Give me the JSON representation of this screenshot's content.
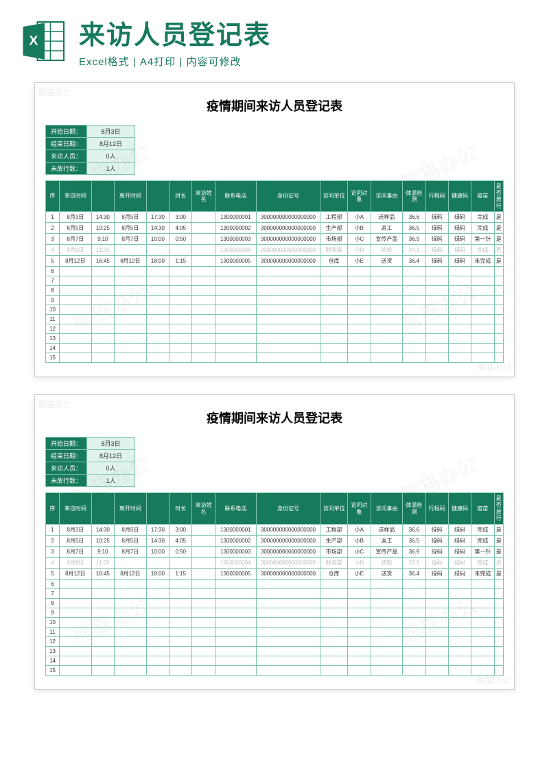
{
  "header": {
    "main_title": "来访人员登记表",
    "sub_title": "Excel格式 | A4打印 | 内容可修改"
  },
  "sheet": {
    "title": "疫情期间来访人员登记表",
    "meta": [
      {
        "label": "开始日期：",
        "value": "8月3日"
      },
      {
        "label": "结束日期：",
        "value": "8月12日"
      },
      {
        "label": "来访人员：",
        "value": "0人"
      },
      {
        "label": "未放行数：",
        "value": "1人"
      }
    ],
    "columns": [
      "序",
      "来访时间",
      "",
      "离开时间",
      "",
      "时长",
      "来访姓名",
      "联系电话",
      "身份证号",
      "访问单位",
      "访问对象",
      "访问事由",
      "体温检测",
      "行程码",
      "健康码",
      "疫苗",
      "是否放行"
    ],
    "rows": [
      {
        "n": "1",
        "d1": "8月3日",
        "t1": "14:30",
        "d2": "8月5日",
        "t2": "17:30",
        "dur": "3:00",
        "name": "",
        "phone": "1300000001",
        "id": "300000000000000000",
        "dept": "工程部",
        "who": "小A",
        "why": "送样品",
        "temp": "36.6",
        "trip": "绿码",
        "health": "绿码",
        "vac": "完成",
        "ok": "是",
        "dim": false
      },
      {
        "n": "2",
        "d1": "8月5日",
        "t1": "10:25",
        "d2": "8月5日",
        "t2": "14:30",
        "dur": "4:05",
        "name": "",
        "phone": "1300000002",
        "id": "300000000000000000",
        "dept": "生产部",
        "who": "小B",
        "why": "返工",
        "temp": "36.5",
        "trip": "绿码",
        "health": "绿码",
        "vac": "完成",
        "ok": "是",
        "dim": false
      },
      {
        "n": "3",
        "d1": "8月7日",
        "t1": "9:10",
        "d2": "8月7日",
        "t2": "10:00",
        "dur": "0:50",
        "name": "",
        "phone": "1300000003",
        "id": "300000000000000000",
        "dept": "市场部",
        "who": "小C",
        "why": "宣传产品",
        "temp": "36.9",
        "trip": "绿码",
        "health": "绿码",
        "vac": "第一针",
        "ok": "是",
        "dim": false
      },
      {
        "n": "4",
        "d1": "8月9日",
        "t1": "11:05",
        "d2": "",
        "t2": "",
        "dur": "",
        "name": "",
        "phone": "1300000004",
        "id": "300000000000000000",
        "dept": "财务部",
        "who": "小D",
        "why": "结款",
        "temp": "37.1",
        "trip": "绿码",
        "health": "绿码",
        "vac": "完成",
        "ok": "否",
        "dim": true
      },
      {
        "n": "5",
        "d1": "8月12日",
        "t1": "16:45",
        "d2": "8月12日",
        "t2": "18:00",
        "dur": "1:15",
        "name": "",
        "phone": "1300000005",
        "id": "300000000000000000",
        "dept": "仓库",
        "who": "小E",
        "why": "送货",
        "temp": "36.4",
        "trip": "绿码",
        "health": "绿码",
        "vac": "未完成",
        "ok": "是",
        "dim": false
      }
    ],
    "empty_rows": [
      "6",
      "7",
      "8",
      "9",
      "10",
      "11",
      "12",
      "13",
      "14",
      "15"
    ]
  },
  "watermark": "熊猫办公",
  "corner_wm": "熊猫办公"
}
